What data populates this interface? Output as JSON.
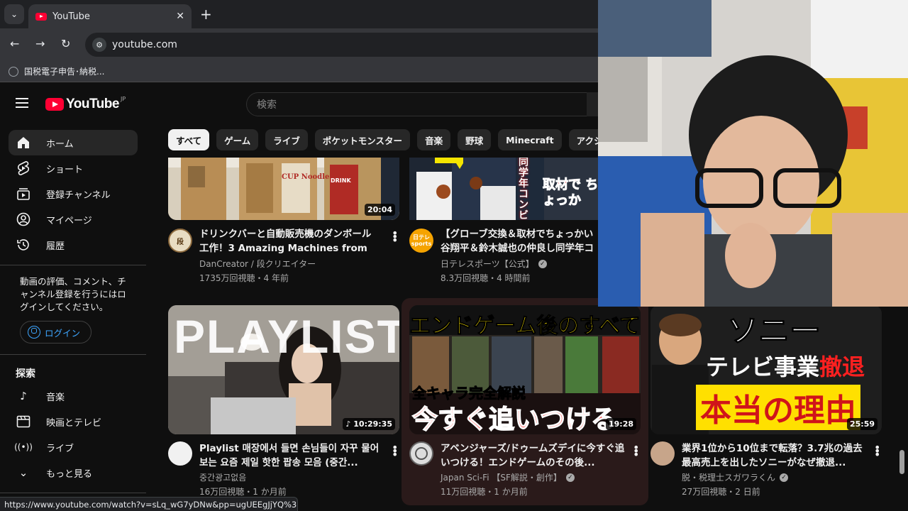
{
  "browser": {
    "tab_title": "YouTube",
    "url": "youtube.com",
    "bookmark": "国税電子申告･納税..."
  },
  "youtube": {
    "logo_text": "YouTube",
    "logo_region": "JP",
    "search_placeholder": "検索"
  },
  "sidebar": {
    "items": [
      {
        "label": "ホーム",
        "icon": "home-icon"
      },
      {
        "label": "ショート",
        "icon": "shorts-icon"
      },
      {
        "label": "登録チャンネル",
        "icon": "subscriptions-icon"
      },
      {
        "label": "マイページ",
        "icon": "account-icon"
      },
      {
        "label": "履歴",
        "icon": "history-icon"
      }
    ],
    "login_message": "動画の評価、コメント、チャンネル登録を行うにはログインしてください。",
    "login_button": "ログイン",
    "explore_heading": "探索",
    "explore_items": [
      {
        "label": "音楽",
        "icon": "music-icon"
      },
      {
        "label": "映画とテレビ",
        "icon": "film-icon"
      },
      {
        "label": "ライブ",
        "icon": "live-icon"
      },
      {
        "label": "もっと見る",
        "icon": "chevron-down-icon"
      }
    ]
  },
  "chips": [
    "すべて",
    "ゲーム",
    "ライブ",
    "ポケットモンスター",
    "音楽",
    "野球",
    "Minecraft",
    "アクシ"
  ],
  "videos": [
    {
      "title": "ドリンクバーと自動販売機のダンボール工作！3 Amazing Machines from ...",
      "channel": "DanCreator / 段クリエイター",
      "meta": "1735万回視聴・4 年前",
      "duration": "20:04",
      "avatar_text": "段",
      "verified": false
    },
    {
      "title": "【グローブ交換＆取材でちょっかい谷翔平＆鈴木誠也の仲良し同学年コ",
      "channel": "日テレスポーツ【公式】",
      "meta": "8.3万回視聴・4 時間前",
      "duration": "",
      "avatar_text": "日テレ sports",
      "verified": true
    },
    {
      "title": "Playlist 매장에서 들면 손님들이 자꾸 물어보는 요즘 제일 핫한 팝송 모음 (중간...",
      "channel": "중간광고없음",
      "meta": "16万回視聴・1 か月前",
      "duration": "10:29:35",
      "avatar_text": "",
      "verified": false
    },
    {
      "title": "アベンジャーズ/ドゥームズデイに今すぐ追いつける！エンドゲームのその後...",
      "channel": "Japan Sci-Fi 【SF解説・創作】",
      "meta": "11万回視聴・1 か月前",
      "duration": "19:28",
      "avatar_text": "",
      "verified": true
    },
    {
      "title": "業界1位から10位まで転落？3.7兆の過去最高売上を出したソニーがなぜ撤退...",
      "channel": "脱・税理士スガワラくん",
      "meta": "27万回視聴・2 日前",
      "duration": "25:59",
      "avatar_text": "",
      "verified": true
    }
  ],
  "thumb_text": {
    "cup_noodle": "CUP Noodle",
    "drink": "DRINK",
    "baseball_side": "同学年コンビ",
    "baseball_main": "取材で ちょっか",
    "playlist": "PLAYLIST",
    "endgame_top": "エンドゲーム後のすべて",
    "endgame_mid": "全キャラ完全解説",
    "endgame_bottom": "今すぐ追いつける",
    "sony_1": "ソニー",
    "sony_2": "テレビ事業",
    "sony_2b": "撤退",
    "sony_3": "本当の理由"
  },
  "statusbar": "https://www.youtube.com/watch?v=sLq_wG7yDNw&pp=ugUEEgJjYQ%3D%...",
  "colors": {
    "brand_red": "#ff0033",
    "link_blue": "#3ea6ff",
    "background": "#0f0f0f",
    "chip_bg": "#272727"
  }
}
